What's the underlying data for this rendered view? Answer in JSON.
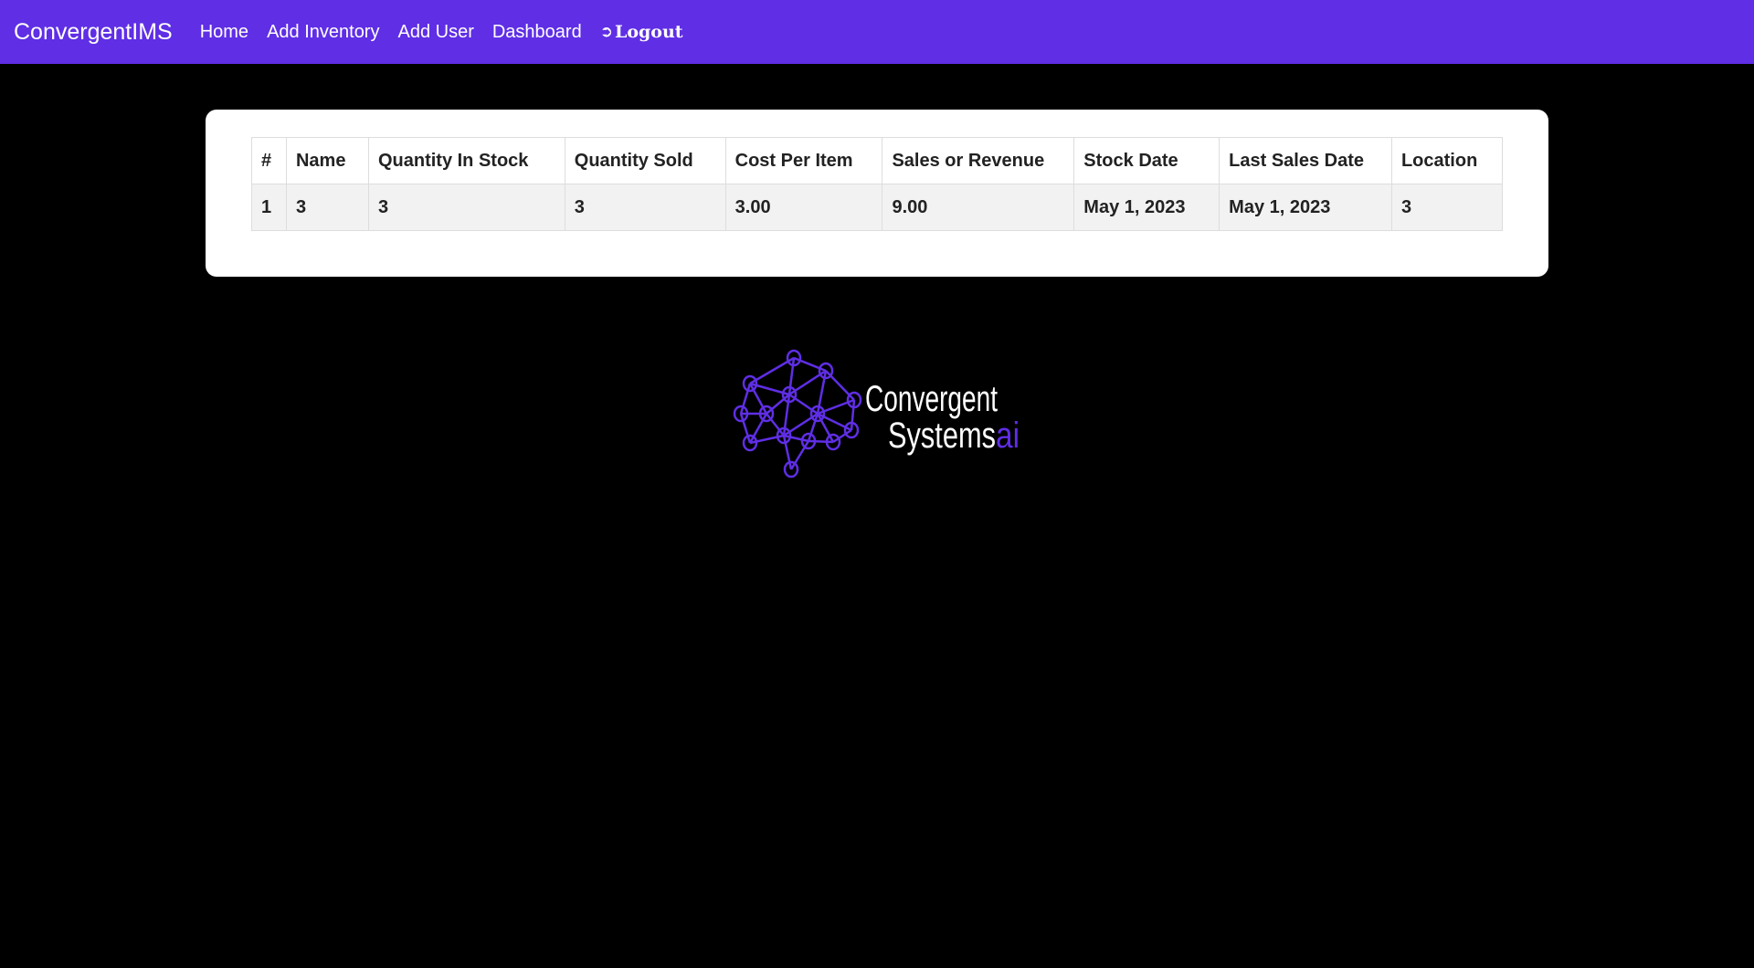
{
  "nav": {
    "brand": "ConvergentIMS",
    "links": [
      "Home",
      "Add Inventory",
      "Add User",
      "Dashboard"
    ],
    "logout": "Logout",
    "logout_icon": "sign-out-icon"
  },
  "table": {
    "headers": [
      "#",
      "Name",
      "Quantity In Stock",
      "Quantity Sold",
      "Cost Per Item",
      "Sales or Revenue",
      "Stock Date",
      "Last Sales Date",
      "Location"
    ],
    "rows": [
      [
        "1",
        "3",
        "3",
        "3",
        "3.00",
        "9.00",
        "May 1, 2023",
        "May 1, 2023",
        "3"
      ]
    ]
  },
  "logo": {
    "line1": "Convergent",
    "line2": "Systems",
    "suffix": "ai",
    "accent": "#5f2ee5"
  },
  "colors": {
    "navbar": "#5f2ee5",
    "background": "#000000",
    "card": "#ffffff"
  }
}
